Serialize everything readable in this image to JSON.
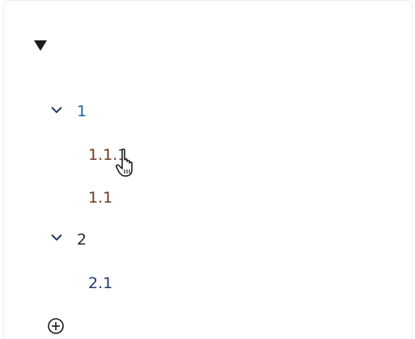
{
  "tree": {
    "root_toggle_icon": "triangle-down-icon",
    "nodes": [
      {
        "label": "1",
        "expanded": true,
        "chevron_icon": "chevron-down-icon",
        "children": [
          {
            "label": "1.1.1"
          },
          {
            "label": "1.1"
          }
        ]
      },
      {
        "label": "2",
        "expanded": true,
        "chevron_icon": "chevron-down-icon",
        "children": [
          {
            "label": "2.1"
          }
        ]
      }
    ],
    "add_icon": "circle-plus-icon"
  },
  "pointer": {
    "icon": "hand-pointer-icon",
    "hovering": "tree.nodes.0.children.0"
  },
  "colors": {
    "parent_node_1": "#1c5fa8",
    "parent_node_2": "#2b2b2b",
    "child_text": "#6b3a1e",
    "child_2_1": "#1f3a63",
    "chevron": "#1f3a63",
    "icon_dark": "#1a1a1a"
  }
}
